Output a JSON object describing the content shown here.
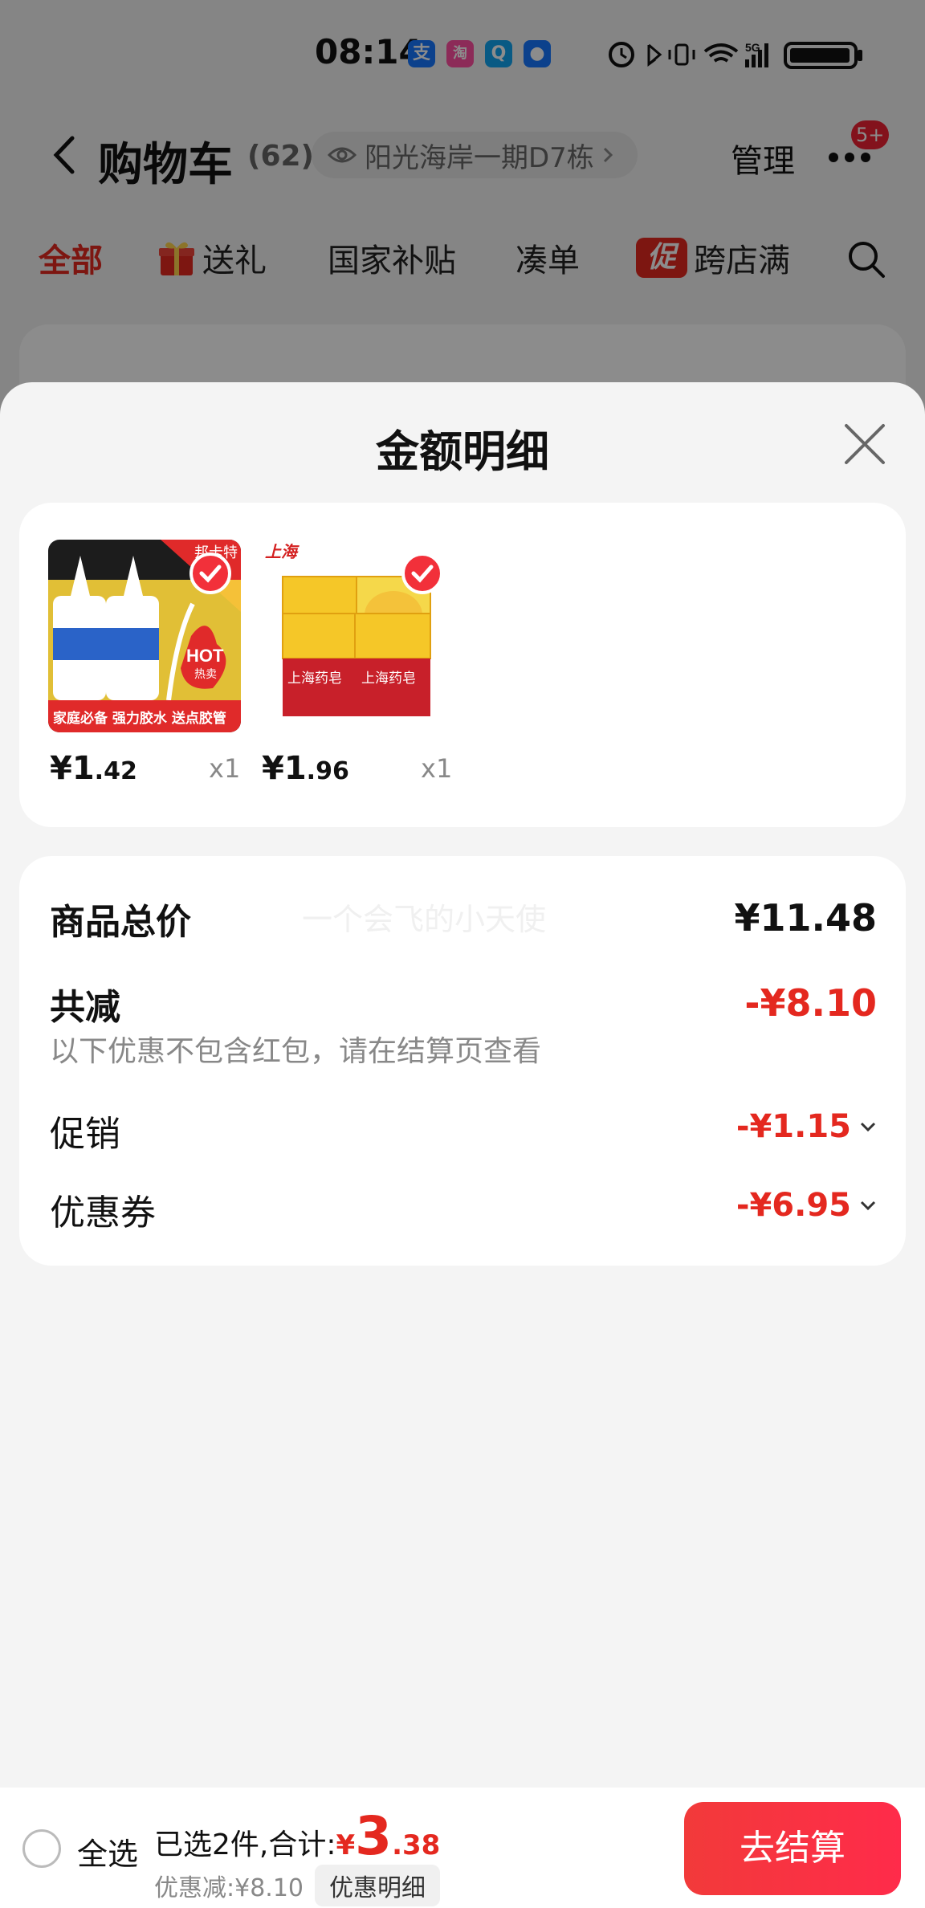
{
  "status_bar": {
    "time": "08:14",
    "apps": [
      {
        "icon": "alipay-icon",
        "glyph": "支",
        "color": "#1677ff"
      },
      {
        "icon": "taobao-flash-icon",
        "glyph": "淘",
        "color": "#ff4fa0"
      },
      {
        "icon": "search-app-icon",
        "glyph": "Q",
        "color": "#12a4f0"
      },
      {
        "icon": "bulb-app-icon",
        "glyph": "●",
        "color": "#1677ff"
      }
    ],
    "signal_label": "5G"
  },
  "header": {
    "title": "购物车",
    "count": "(62)",
    "address": "阳光海岸一期D7栋",
    "manage": "管理",
    "badge": "5+"
  },
  "tabs": [
    {
      "label": "全部",
      "active": true
    },
    {
      "label": "送礼",
      "icon": "gift-icon"
    },
    {
      "label": "国家补贴"
    },
    {
      "label": "凑单"
    },
    {
      "label": "跨店满",
      "icon": "promo-icon",
      "icon_text": "促"
    }
  ],
  "sheet": {
    "title": "金额明细",
    "products": [
      {
        "brand": "邦卡特",
        "tag": "HOT",
        "tag_sub": "热卖",
        "caption": "家庭必备 强力胶水 送点胶管",
        "price_int": "¥1",
        "price_dec": ".42",
        "qty": "x1"
      },
      {
        "brand": "上海",
        "caption": "上海药皂",
        "price_int": "¥1",
        "price_dec": ".96",
        "qty": "x1"
      }
    ],
    "summary": {
      "total_label": "商品总价",
      "total_value": "¥11.48",
      "watermark": "一个会飞的小天使",
      "reduce_label": "共减",
      "reduce_value": "-¥8.10",
      "note": "以下优惠不包含红包，请在结算页查看",
      "promo_label": "促销",
      "promo_value": "-¥1.15",
      "coupon_label": "优惠券",
      "coupon_value": "-¥6.95"
    }
  },
  "bottom_bar": {
    "select_all": "全选",
    "selected_prefix": "已选2件,合计:",
    "total_yen": "¥",
    "total_int": "3",
    "total_dec": ".38",
    "discount": "优惠减:¥8.10",
    "detail_chip": "优惠明细",
    "checkout": "去结算"
  },
  "colors": {
    "accent_red": "#e4281f",
    "button_red": "#f23a3a"
  }
}
